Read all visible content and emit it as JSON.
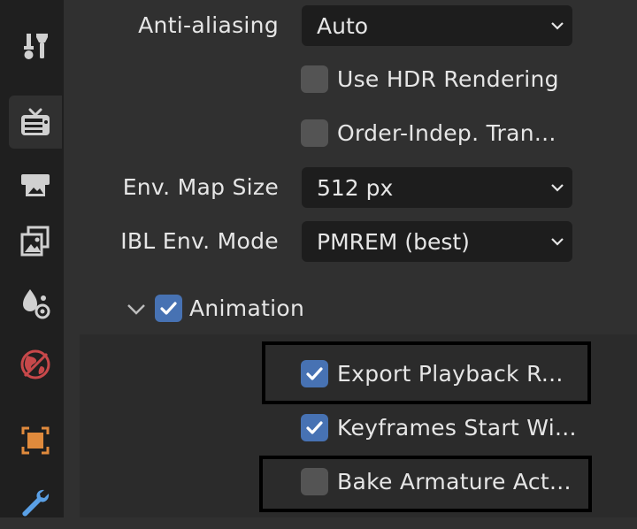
{
  "sidebar": {
    "tabs": [
      {
        "icon": "tool-icon",
        "active": false
      },
      {
        "icon": "render-icon",
        "active": true
      },
      {
        "icon": "output-icon",
        "active": false
      },
      {
        "icon": "view-layer-icon",
        "active": false
      },
      {
        "icon": "scene-icon",
        "active": false
      },
      {
        "icon": "world-icon",
        "active": false
      },
      {
        "icon": "object-icon",
        "active": false
      },
      {
        "icon": "modifier-wrench-icon",
        "active": false
      }
    ]
  },
  "settings": {
    "anti_aliasing": {
      "label": "Anti-aliasing",
      "value": "Auto"
    },
    "use_hdr": {
      "label": "Use HDR Rendering",
      "checked": false
    },
    "order_indep": {
      "label": "Order-Indep. Tran...",
      "checked": false
    },
    "env_map_size": {
      "label": "Env. Map Size",
      "value": "512 px"
    },
    "ibl_env_mode": {
      "label": "IBL Env. Mode",
      "value": "PMREM (best)"
    }
  },
  "animation": {
    "label": "Animation",
    "checked": true,
    "expanded": true,
    "items": [
      {
        "label": "Export Playback R...",
        "checked": true,
        "highlighted": true
      },
      {
        "label": "Keyframes Start Wi...",
        "checked": true,
        "highlighted": false
      },
      {
        "label": "Bake Armature Act...",
        "checked": false,
        "highlighted": true
      }
    ]
  },
  "colors": {
    "checkbox_checked": "#4772b3",
    "checkbox_unchecked": "#545454",
    "dropdown_bg": "#1d1d1d",
    "panel_bg": "#303030",
    "sidebar_bg": "#1f1f1f",
    "highlight_border": "#000000"
  }
}
